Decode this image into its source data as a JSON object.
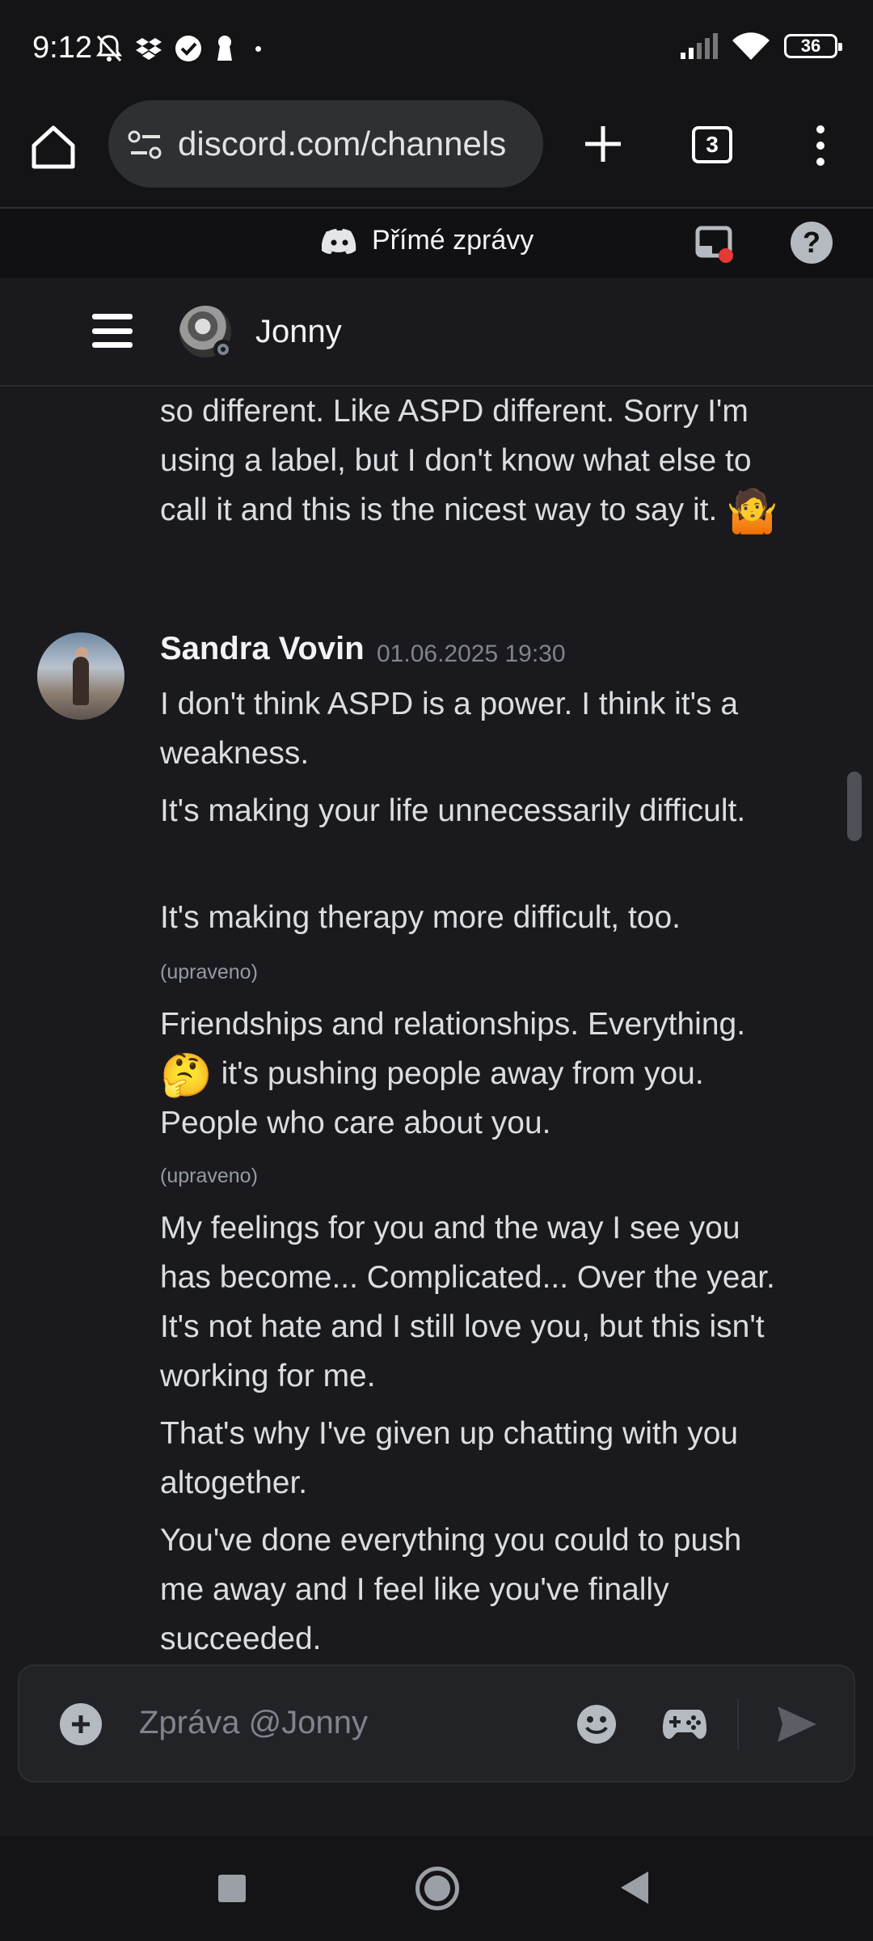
{
  "status_bar": {
    "time": "9:12",
    "battery": "36",
    "icons": [
      "bell-off-icon",
      "dropbox-icon",
      "check-circle-icon",
      "keyhole-icon",
      "signal-icon",
      "wifi-icon",
      "battery-icon"
    ]
  },
  "browser": {
    "url": "discord.com/channels",
    "tab_count": "3"
  },
  "app_header": {
    "title": "Přímé zprávy"
  },
  "channel": {
    "name": "Jonny"
  },
  "messages": {
    "continuation_lines": "so different. Like ASPD different. Sorry I'm using a label, but I don't know what else to call it and this is the nicest way to say it.",
    "continuation_emoji": "🤷",
    "author": "Sandra Vovin",
    "timestamp": "01.06.2025 19:30",
    "m1": "I don't think ASPD is a power. I think it's a weakness.",
    "m2": "It's making your life unnecessarily difficult.",
    "m3": "It's making therapy more difficult, too.",
    "m3_edited": "(upraveno)",
    "m4a": "Friendships and relationships. Everything.",
    "m4_emoji": "🤔",
    "m4b": "it's pushing people away from you. People who care about you.",
    "m4_edited": "(upraveno)",
    "m5": "My feelings for you and the way I see you has become... Complicated... Over the year. It's not hate and I still love you, but this isn't working for me.",
    "m6": "That's why I've given up chatting with you altogether.",
    "m7": "You've done everything you could to push me away and I feel like you've finally succeeded."
  },
  "composer": {
    "placeholder": "Zpráva @Jonny"
  },
  "colors": {
    "background": "#1a1a1e",
    "text": "#dbdee1",
    "muted": "#80848e",
    "notification_dot": "#e53935"
  }
}
